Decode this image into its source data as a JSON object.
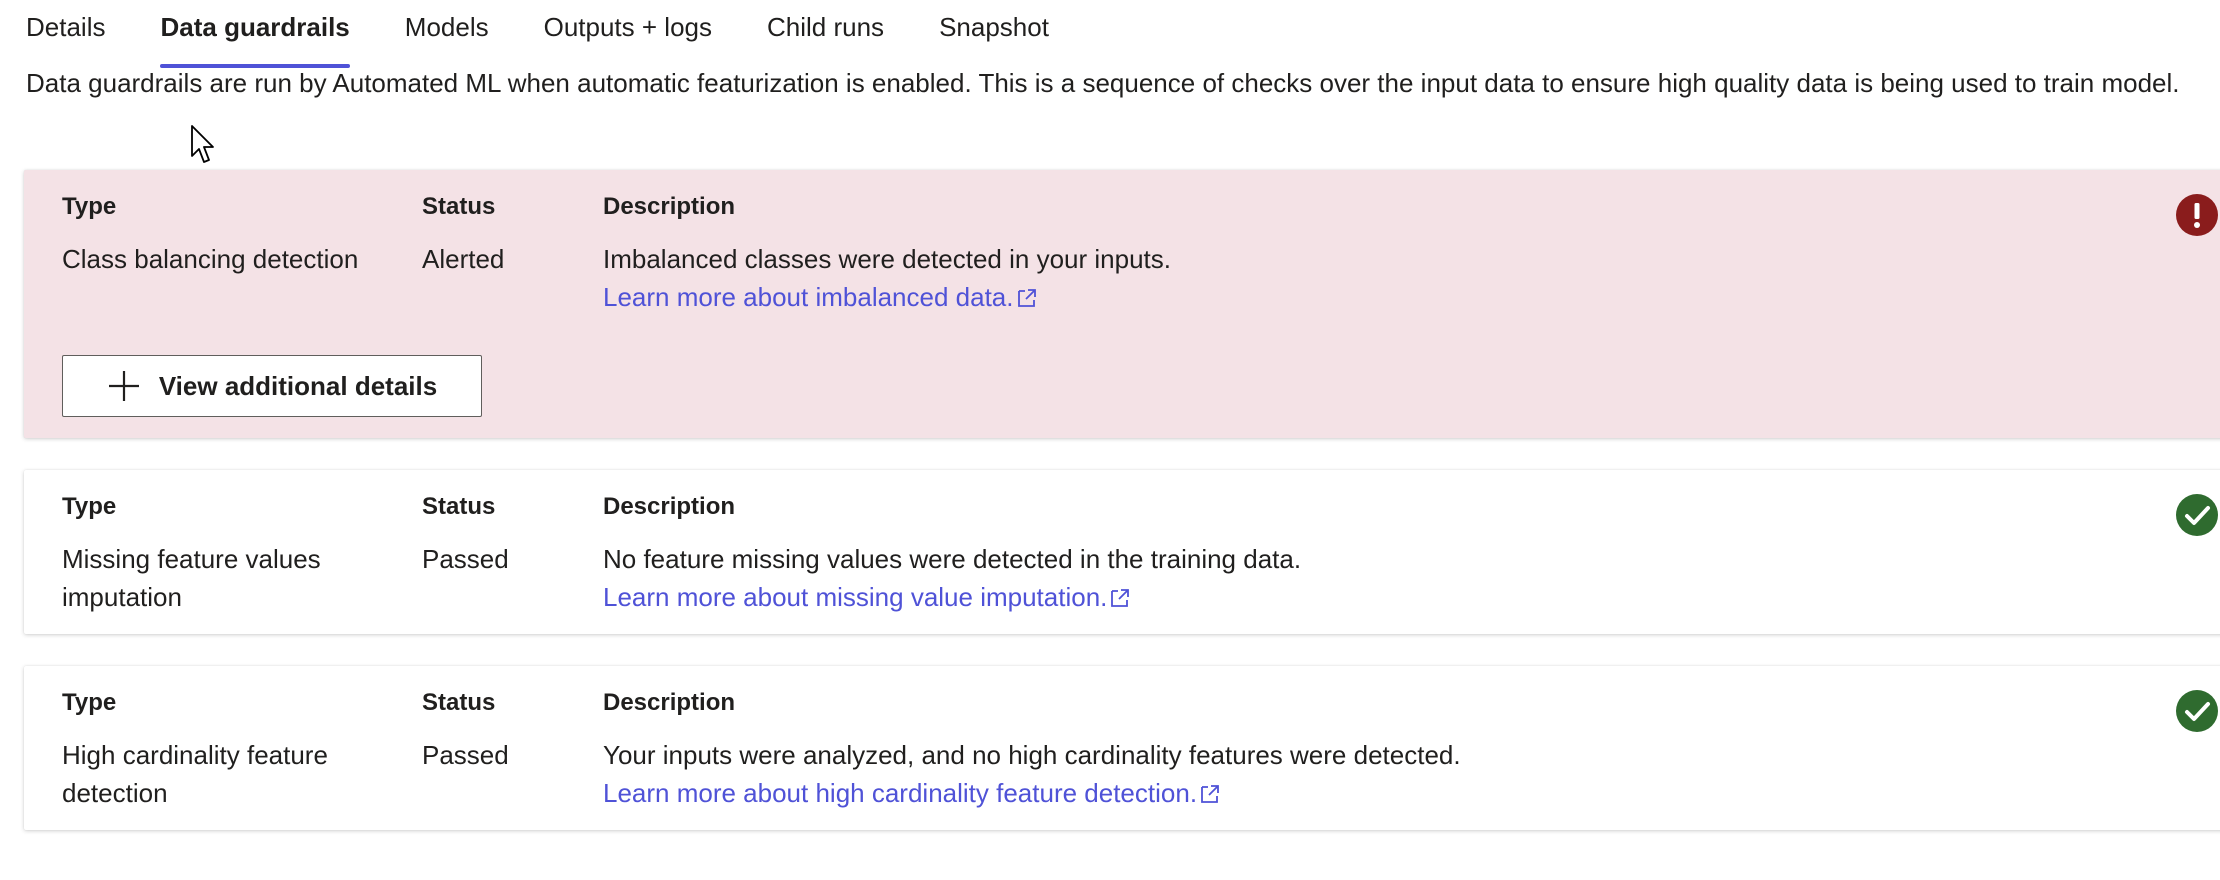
{
  "tabs": [
    {
      "label": "Details",
      "active": false
    },
    {
      "label": "Data guardrails",
      "active": true
    },
    {
      "label": "Models",
      "active": false
    },
    {
      "label": "Outputs + logs",
      "active": false
    },
    {
      "label": "Child runs",
      "active": false
    },
    {
      "label": "Snapshot",
      "active": false
    }
  ],
  "intro": "Data guardrails are run by Automated ML when automatic featurization is enabled. This is a sequence of checks over the input data to ensure high quality data is being used to train model.",
  "column_headers": {
    "type": "Type",
    "status": "Status",
    "description": "Description"
  },
  "guardrails": [
    {
      "type": "Class balancing detection",
      "status": "Alerted",
      "description": "Imbalanced classes were detected in your inputs.",
      "link": "Learn more about imbalanced data.",
      "icon": "error-icon",
      "button_label": "View additional details"
    },
    {
      "type": "Missing feature values imputation",
      "status": "Passed",
      "description": "No feature missing values were detected in the training data.",
      "link": "Learn more about missing value imputation.",
      "icon": "checkmark-icon"
    },
    {
      "type": "High cardinality feature detection",
      "status": "Passed",
      "description": "Your inputs were analyzed, and no high cardinality features were detected.",
      "link": "Learn more about high cardinality feature detection.",
      "icon": "checkmark-icon"
    }
  ],
  "colors": {
    "accent": "#4f52d7",
    "alert_background": "#f4e2e6",
    "error": "#8a1c1c",
    "success": "#2f6b2f"
  }
}
